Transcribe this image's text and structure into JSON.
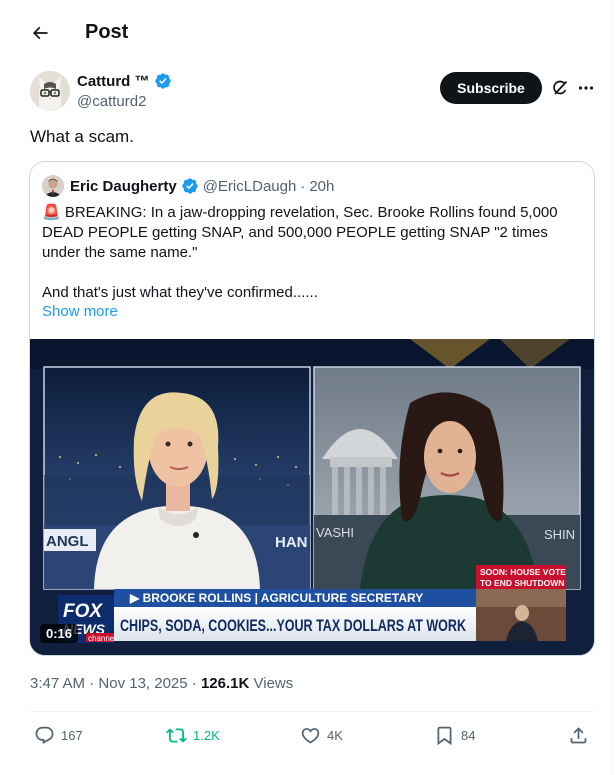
{
  "header": {
    "title": "Post",
    "back_icon": "arrow-left-icon"
  },
  "author": {
    "name": "Catturd ™",
    "handle": "@catturd2",
    "verified_color": "#1d9bf0",
    "subscribe_label": "Subscribe"
  },
  "post": {
    "text": "What a scam."
  },
  "quote": {
    "name": "Eric Daugherty",
    "handle": "@EricLDaugh",
    "separator": "·",
    "time": "20h",
    "lines": [
      "🚨 BREAKING: In a jaw-dropping revelation, Sec. Brooke Rollins found 5,000",
      "DEAD PEOPLE getting SNAP, and 500,000 PEOPLE getting SNAP \"2 times",
      "under the same name.\"",
      "",
      "And that's just what they've confirmed......"
    ],
    "show_more": "Show more",
    "video": {
      "duration": "0:16",
      "lower_third_name": "▶ BROOKE ROLLINS | AGRICULTURE SECRETARY",
      "headline": "CHIPS, SODA, COOKIES...YOUR TAX DOLLARS AT WORK",
      "soon_line1": "SOON: HOUSE VOTE",
      "soon_line2": "TO END SHUTDOWN",
      "logo_line1": "FOX",
      "logo_line2": "NEWS",
      "logo_line3": "channel",
      "bg_left_text": "ANGL",
      "bg_mid_text": "HAN",
      "bg_right_text_1": "VASHI",
      "bg_right_text_2": "SHIN"
    }
  },
  "meta": {
    "time": "3:47 AM",
    "separator": "·",
    "date": "Nov 13, 2025",
    "views_count": "126.1K",
    "views_label": "Views"
  },
  "actions": {
    "replies": "167",
    "reposts": "1.2K",
    "likes": "4K",
    "bookmarks": "84",
    "repost_color": "#00ba7c"
  }
}
